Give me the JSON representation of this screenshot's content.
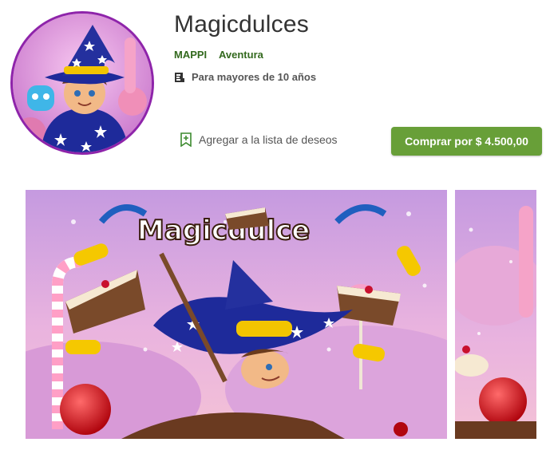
{
  "app": {
    "title": "Magicdulces",
    "developer": "MAPPI",
    "genre": "Aventura",
    "rating": "Para mayores de 10 años",
    "icon": "wizard-app-icon"
  },
  "actions": {
    "wishlist_label": "Agregar a la lista de deseos",
    "wishlist_icon": "bookmark-add-icon",
    "buy_label": "Comprar por $ 4.500,00"
  },
  "screenshots": {
    "main_logo_text": "Magicdulce"
  },
  "colors": {
    "accent_green": "#689f38",
    "link_green": "#33691e",
    "icon_border": "#8e24aa"
  }
}
